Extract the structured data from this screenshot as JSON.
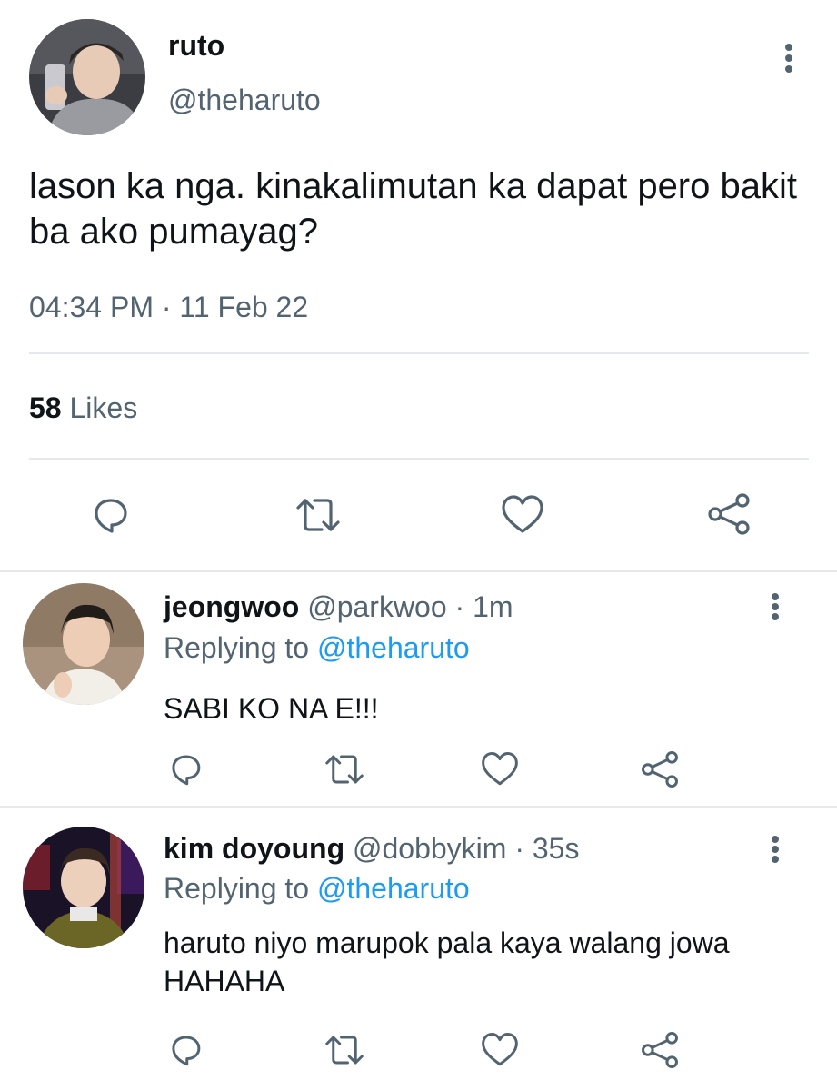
{
  "tweet": {
    "display_name": "ruto",
    "handle": "@theharuto",
    "text": "lason ka nga. kinakalimutan ka dapat pero bakit ba ako pumayag?",
    "timestamp": "04:34 PM · 11 Feb 22",
    "likes_count": "58",
    "likes_label": "Likes"
  },
  "replies": [
    {
      "display_name": "jeongwoo",
      "handle_time": "@parkwoo · 1m",
      "replying_prefix": "Replying to",
      "replying_to": "@theharuto",
      "text": "SABI KO NA E!!!"
    },
    {
      "display_name": "kim doyoung",
      "handle_time": "@dobbykim · 35s",
      "replying_prefix": "Replying to",
      "replying_to": "@theharuto",
      "text": "haruto niyo marupok pala kaya walang jowa HAHAHA"
    }
  ],
  "icons": {
    "reply": "reply-bubble-icon",
    "retweet": "retweet-icon",
    "like": "heart-icon",
    "share": "share-icon",
    "more": "more-vertical-icon"
  },
  "colors": {
    "text": "#0f1419",
    "secondary": "#536471",
    "mention": "#1d9bf0",
    "divider": "#e6e9eb"
  }
}
